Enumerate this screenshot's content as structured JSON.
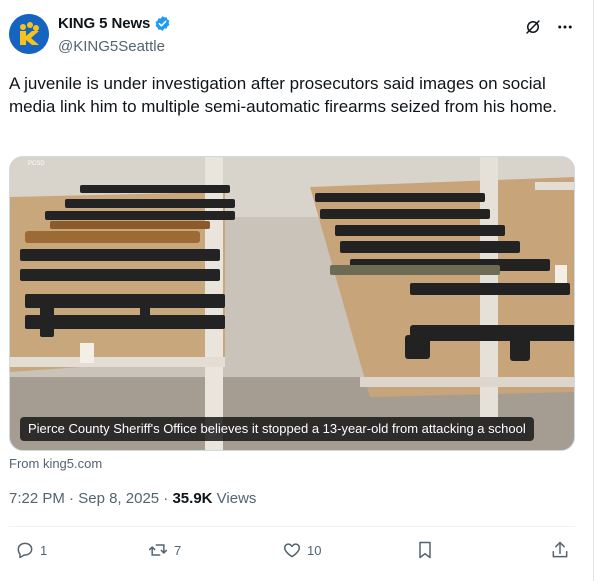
{
  "author": {
    "display_name": "KING 5 News",
    "handle": "@KING5Seattle",
    "verified": true,
    "avatar_icon": "king5-logo-icon",
    "brand_color": "#1565c0"
  },
  "tweet": {
    "text": "A juvenile is under investigation after prosecutors said images on social media link him to multiple semi-automatic firearms seized from his home.",
    "media": {
      "watermark": "PCSD",
      "caption": "Pierce County Sheriff's Office believes it stopped a 13-year-old from attacking a school"
    },
    "source": "From king5.com",
    "time": "7:22 PM",
    "separator": "·",
    "date": "Sep 8, 2025",
    "views_count": "35.9K",
    "views_label": "Views"
  },
  "actions": {
    "replies": "1",
    "reposts": "7",
    "likes": "10"
  },
  "colors": {
    "text_primary": "#0f1419",
    "text_secondary": "#536471",
    "verified_blue": "#1d9bf0"
  }
}
